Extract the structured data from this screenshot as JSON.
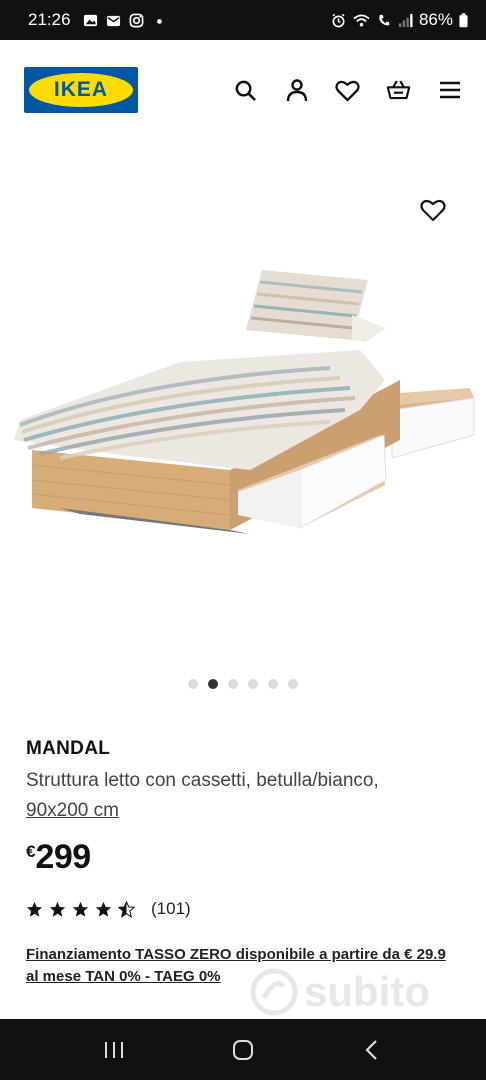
{
  "status_bar": {
    "time": "21:26",
    "battery": "86%"
  },
  "brand": {
    "logo_text": "IKEA",
    "blue": "#0058a3",
    "yellow": "#ffdb00"
  },
  "header": {
    "icons": [
      "search-icon",
      "account-icon",
      "heart-icon",
      "basket-icon",
      "menu-icon"
    ]
  },
  "gallery": {
    "image_count": 6,
    "active_index": 1
  },
  "product": {
    "name": "MANDAL",
    "description": "Struttura letto con cassetti, betulla/bianco,",
    "size": "90x200 cm",
    "currency": "€",
    "price": "299",
    "rating": 4.5,
    "review_count": "(101)",
    "financing": "Finanziamento TASSO ZERO disponibile a partire da € 29.9 al mese TAN 0% - TAEG 0%"
  },
  "watermark": {
    "text": "subito"
  }
}
